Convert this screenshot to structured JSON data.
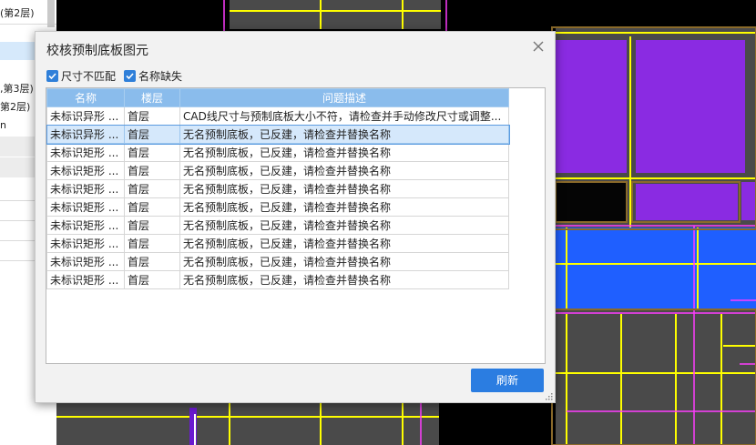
{
  "left_panel": {
    "items": [
      "(第2层)",
      "",
      "",
      ",第3层)",
      "第2层)",
      "n"
    ]
  },
  "dialog": {
    "title": "校核预制底板图元",
    "filters": [
      {
        "label": "尺寸不匹配",
        "checked": true
      },
      {
        "label": "名称缺失",
        "checked": true
      }
    ],
    "columns": [
      "名称",
      "楼层",
      "问题描述"
    ],
    "rows": [
      {
        "name": "未标识异形 ...",
        "floor": "首层",
        "desc": "CAD线尺寸与预制底板大小不符，请检查并手动修改尺寸或调整..."
      },
      {
        "name": "未标识异形 ...",
        "floor": "首层",
        "desc": "无名预制底板，已反建，请检查并替换名称"
      },
      {
        "name": "未标识矩形 ...",
        "floor": "首层",
        "desc": "无名预制底板，已反建，请检查并替换名称"
      },
      {
        "name": "未标识矩形 ...",
        "floor": "首层",
        "desc": "无名预制底板，已反建，请检查并替换名称"
      },
      {
        "name": "未标识矩形 ...",
        "floor": "首层",
        "desc": "无名预制底板，已反建，请检查并替换名称"
      },
      {
        "name": "未标识矩形 ...",
        "floor": "首层",
        "desc": "无名预制底板，已反建，请检查并替换名称"
      },
      {
        "name": "未标识矩形 ...",
        "floor": "首层",
        "desc": "无名预制底板，已反建，请检查并替换名称"
      },
      {
        "name": "未标识矩形 ...",
        "floor": "首层",
        "desc": "无名预制底板，已反建，请检查并替换名称"
      },
      {
        "name": "未标识矩形 ...",
        "floor": "首层",
        "desc": "无名预制底板，已反建，请检查并替换名称"
      },
      {
        "name": "未标识矩形 ...",
        "floor": "首层",
        "desc": "无名预制底板，已反建，请检查并替换名称"
      }
    ],
    "selected_row": 1,
    "refresh_label": "刷新"
  },
  "colors": {
    "accent": "#2b7de1",
    "header": "#8abcec",
    "selection": "#d5e8fb",
    "cad_purple": "#8a2be2",
    "cad_blue": "#1f5fff",
    "cad_yellow": "#ffff00",
    "cad_magenta": "#ff3cff"
  },
  "icons": {
    "close": "close-icon",
    "check": "check-icon",
    "resize": "resize-grip-icon"
  }
}
